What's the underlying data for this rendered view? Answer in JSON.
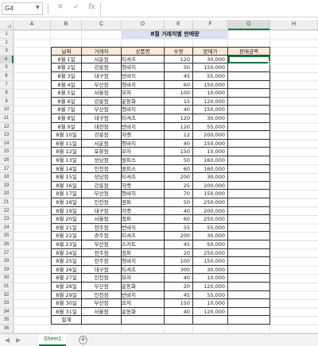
{
  "formula_bar": {
    "name_box": "G4",
    "cancel_icon": "✕",
    "enter_icon": "✓",
    "fx_label": "fx",
    "formula": ""
  },
  "columns": [
    "A",
    "B",
    "C",
    "D",
    "E",
    "F",
    "G",
    "H"
  ],
  "active_column": "G",
  "active_row": 4,
  "rows": [
    "1",
    "2",
    "3",
    "4",
    "5",
    "6",
    "7",
    "8",
    "9",
    "10",
    "11",
    "12",
    "13",
    "14",
    "15",
    "16",
    "17",
    "18",
    "19",
    "20",
    "21",
    "22",
    "23",
    "24",
    "25",
    "26",
    "27",
    "28",
    "29",
    "30",
    "31",
    "32",
    "33",
    "34",
    "35",
    "36"
  ],
  "sheet": {
    "title": "8월 거래처별 판매량",
    "headers": [
      "날짜",
      "거래처",
      "상품명",
      "수량",
      "판매가",
      "판매금액"
    ],
    "records": [
      [
        "8월 1일",
        "서운점",
        "티셔츠",
        "120",
        "30,000"
      ],
      [
        "8월 2일",
        "강릉점",
        "청바지",
        "50",
        "150,000"
      ],
      [
        "8월 3일",
        "대구점",
        "반바지",
        "45",
        "55,000"
      ],
      [
        "8월 4일",
        "부산점",
        "청바지",
        "60",
        "150,000"
      ],
      [
        "8월 5일",
        "서울점",
        "모자",
        "100",
        "10,000"
      ],
      [
        "8월 6일",
        "강릉점",
        "운동화",
        "15",
        "120,000"
      ],
      [
        "8월 7일",
        "부산점",
        "청바지",
        "40",
        "150,000"
      ],
      [
        "8월 8일",
        "대구점",
        "티셔츠",
        "120",
        "30,000"
      ],
      [
        "8월 9일",
        "대전점",
        "반바지",
        "120",
        "55,000"
      ],
      [
        "8월 10일",
        "강릉점",
        "자켓",
        "12",
        "200,000"
      ],
      [
        "8월 11일",
        "서운점",
        "청바지",
        "40",
        "150,000"
      ],
      [
        "8월 12일",
        "포항점",
        "모자",
        "150",
        "10,000"
      ],
      [
        "8월 13일",
        "성남점",
        "원피스",
        "50",
        "160,000"
      ],
      [
        "8월 14일",
        "인천점",
        "원피스",
        "60",
        "160,000"
      ],
      [
        "8월 15일",
        "성남점",
        "티셔츠",
        "200",
        "30,000"
      ],
      [
        "8월 16일",
        "강릉점",
        "자켓",
        "25",
        "200,000"
      ],
      [
        "8월 17일",
        "부산점",
        "청바지",
        "70",
        "150,000"
      ],
      [
        "8월 18일",
        "인천점",
        "점퍼",
        "50",
        "250,000"
      ],
      [
        "8월 19일",
        "대구점",
        "자켓",
        "40",
        "200,000"
      ],
      [
        "8월 20일",
        "서울점",
        "점퍼",
        "60",
        "250,000"
      ],
      [
        "8월 21일",
        "전주점",
        "반바지",
        "55",
        "55,000"
      ],
      [
        "8월 22일",
        "광주점",
        "티셔츠",
        "200",
        "30,000"
      ],
      [
        "8월 23일",
        "부산점",
        "스커트",
        "45",
        "50,000"
      ],
      [
        "8월 24일",
        "전주점",
        "점퍼",
        "20",
        "250,000"
      ],
      [
        "8월 25일",
        "전주점",
        "청바지",
        "100",
        "150,000"
      ],
      [
        "8월 26일",
        "대구점",
        "티셔츠",
        "300",
        "30,000"
      ],
      [
        "8월 27일",
        "인천점",
        "모자",
        "40",
        "10,000"
      ],
      [
        "8월 28일",
        "부산점",
        "운동화",
        "20",
        "120,000"
      ],
      [
        "8월 29일",
        "인천점",
        "반바지",
        "45",
        "55,000"
      ],
      [
        "8월 30일",
        "부산점",
        "모자",
        "150",
        "10,000"
      ],
      [
        "8월 31일",
        "서울점",
        "운동화",
        "40",
        "120,000"
      ]
    ],
    "total_label": "합계"
  },
  "tabs": {
    "prev_icon": "◀",
    "next_icon": "▶",
    "sheet_name": "Sheet1",
    "add_icon": "+"
  }
}
